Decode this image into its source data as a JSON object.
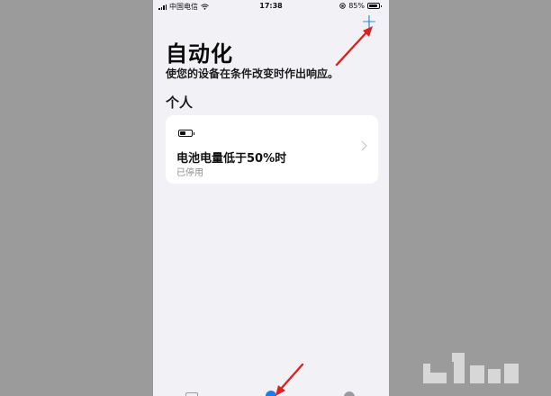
{
  "status_bar": {
    "carrier": "中国电信",
    "time": "17:38",
    "battery_text": "85%"
  },
  "header": {
    "add_label": "+",
    "title": "自动化",
    "subtitle": "使您的设备在条件改变时作出响应。"
  },
  "section": {
    "title": "个人"
  },
  "automation_card": {
    "icon": "battery-icon",
    "title": "电池电量低于50%时",
    "status": "已停用"
  },
  "colors": {
    "accent": "#1a7cf2",
    "annotation_arrow": "#d9231e",
    "background": "#f2f1f6"
  }
}
